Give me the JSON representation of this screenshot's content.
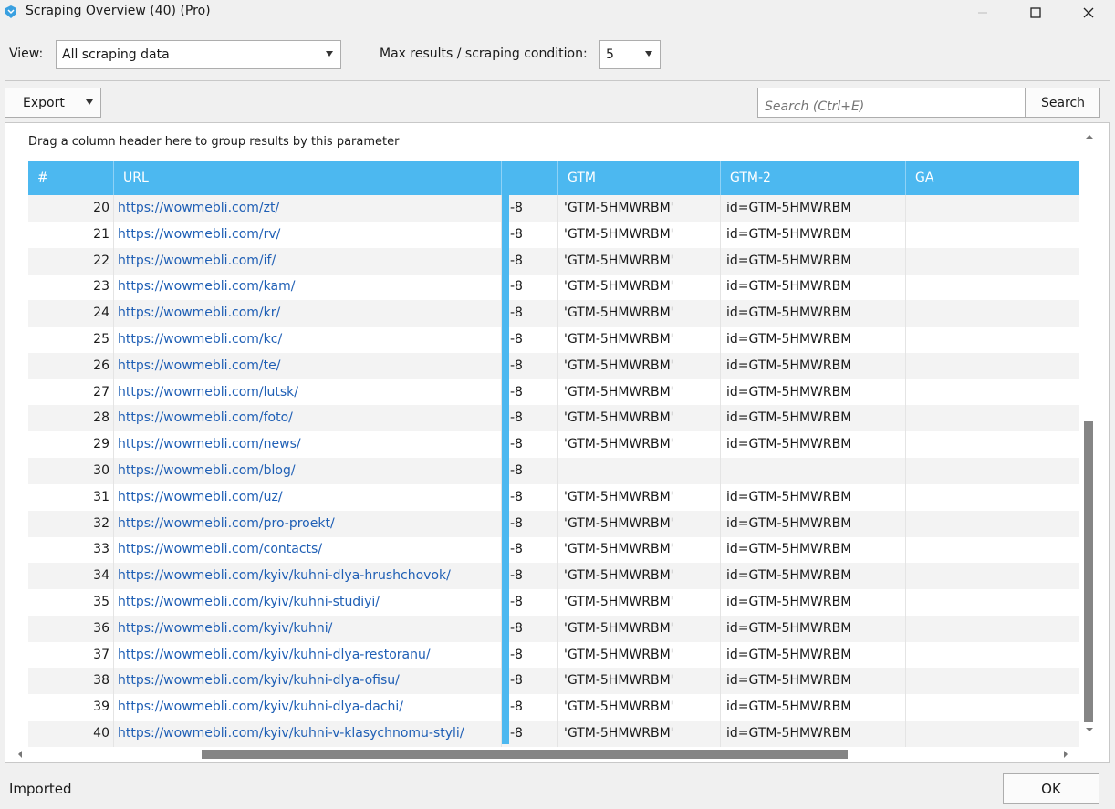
{
  "window": {
    "title": "Scraping Overview (40) (Pro)"
  },
  "toolbar": {
    "view_label": "View:",
    "view_value": "All scraping data",
    "max_label": "Max results / scraping condition:",
    "max_value": "5",
    "export_label": "Export",
    "search_placeholder": "Search (Ctrl+E)",
    "search_button": "Search"
  },
  "grid": {
    "group_hint": "Drag a column header here to group results by this parameter",
    "columns": [
      "#",
      "URL",
      "",
      "GTM",
      "GTM-2",
      "GA"
    ],
    "rows": [
      {
        "num": "20",
        "url": "https://wowmebli.com/zt/",
        "part": "-8",
        "gtm": "'GTM-5HMWRBM'",
        "gtm2": "id=GTM-5HMWRBM",
        "ga": ""
      },
      {
        "num": "21",
        "url": "https://wowmebli.com/rv/",
        "part": "-8",
        "gtm": "'GTM-5HMWRBM'",
        "gtm2": "id=GTM-5HMWRBM",
        "ga": ""
      },
      {
        "num": "22",
        "url": "https://wowmebli.com/if/",
        "part": "-8",
        "gtm": "'GTM-5HMWRBM'",
        "gtm2": "id=GTM-5HMWRBM",
        "ga": ""
      },
      {
        "num": "23",
        "url": "https://wowmebli.com/kam/",
        "part": "-8",
        "gtm": "'GTM-5HMWRBM'",
        "gtm2": "id=GTM-5HMWRBM",
        "ga": ""
      },
      {
        "num": "24",
        "url": "https://wowmebli.com/kr/",
        "part": "-8",
        "gtm": "'GTM-5HMWRBM'",
        "gtm2": "id=GTM-5HMWRBM",
        "ga": ""
      },
      {
        "num": "25",
        "url": "https://wowmebli.com/kc/",
        "part": "-8",
        "gtm": "'GTM-5HMWRBM'",
        "gtm2": "id=GTM-5HMWRBM",
        "ga": ""
      },
      {
        "num": "26",
        "url": "https://wowmebli.com/te/",
        "part": "-8",
        "gtm": "'GTM-5HMWRBM'",
        "gtm2": "id=GTM-5HMWRBM",
        "ga": ""
      },
      {
        "num": "27",
        "url": "https://wowmebli.com/lutsk/",
        "part": "-8",
        "gtm": "'GTM-5HMWRBM'",
        "gtm2": "id=GTM-5HMWRBM",
        "ga": ""
      },
      {
        "num": "28",
        "url": "https://wowmebli.com/foto/",
        "part": "-8",
        "gtm": "'GTM-5HMWRBM'",
        "gtm2": "id=GTM-5HMWRBM",
        "ga": ""
      },
      {
        "num": "29",
        "url": "https://wowmebli.com/news/",
        "part": "-8",
        "gtm": "'GTM-5HMWRBM'",
        "gtm2": "id=GTM-5HMWRBM",
        "ga": ""
      },
      {
        "num": "30",
        "url": "https://wowmebli.com/blog/",
        "part": "-8",
        "gtm": "",
        "gtm2": "",
        "ga": ""
      },
      {
        "num": "31",
        "url": "https://wowmebli.com/uz/",
        "part": "-8",
        "gtm": "'GTM-5HMWRBM'",
        "gtm2": "id=GTM-5HMWRBM",
        "ga": ""
      },
      {
        "num": "32",
        "url": "https://wowmebli.com/pro-proekt/",
        "part": "-8",
        "gtm": "'GTM-5HMWRBM'",
        "gtm2": "id=GTM-5HMWRBM",
        "ga": ""
      },
      {
        "num": "33",
        "url": "https://wowmebli.com/contacts/",
        "part": "-8",
        "gtm": "'GTM-5HMWRBM'",
        "gtm2": "id=GTM-5HMWRBM",
        "ga": ""
      },
      {
        "num": "34",
        "url": "https://wowmebli.com/kyiv/kuhni-dlya-hrushchovok/",
        "part": "-8",
        "gtm": "'GTM-5HMWRBM'",
        "gtm2": "id=GTM-5HMWRBM",
        "ga": ""
      },
      {
        "num": "35",
        "url": "https://wowmebli.com/kyiv/kuhni-studiyi/",
        "part": "-8",
        "gtm": "'GTM-5HMWRBM'",
        "gtm2": "id=GTM-5HMWRBM",
        "ga": ""
      },
      {
        "num": "36",
        "url": "https://wowmebli.com/kyiv/kuhni/",
        "part": "-8",
        "gtm": "'GTM-5HMWRBM'",
        "gtm2": "id=GTM-5HMWRBM",
        "ga": ""
      },
      {
        "num": "37",
        "url": "https://wowmebli.com/kyiv/kuhni-dlya-restoranu/",
        "part": "-8",
        "gtm": "'GTM-5HMWRBM'",
        "gtm2": "id=GTM-5HMWRBM",
        "ga": ""
      },
      {
        "num": "38",
        "url": "https://wowmebli.com/kyiv/kuhni-dlya-ofisu/",
        "part": "-8",
        "gtm": "'GTM-5HMWRBM'",
        "gtm2": "id=GTM-5HMWRBM",
        "ga": ""
      },
      {
        "num": "39",
        "url": "https://wowmebli.com/kyiv/kuhni-dlya-dachi/",
        "part": "-8",
        "gtm": "'GTM-5HMWRBM'",
        "gtm2": "id=GTM-5HMWRBM",
        "ga": ""
      },
      {
        "num": "40",
        "url": "https://wowmebli.com/kyiv/kuhni-v-klasychnomu-styli/",
        "part": "-8",
        "gtm": "'GTM-5HMWRBM'",
        "gtm2": "id=GTM-5HMWRBM",
        "ga": ""
      }
    ]
  },
  "footer": {
    "status": "Imported",
    "ok_label": "OK"
  },
  "colors": {
    "header_bg": "#4cb8f0",
    "link": "#1f5fb5",
    "alt_row": "#f3f3f3"
  }
}
